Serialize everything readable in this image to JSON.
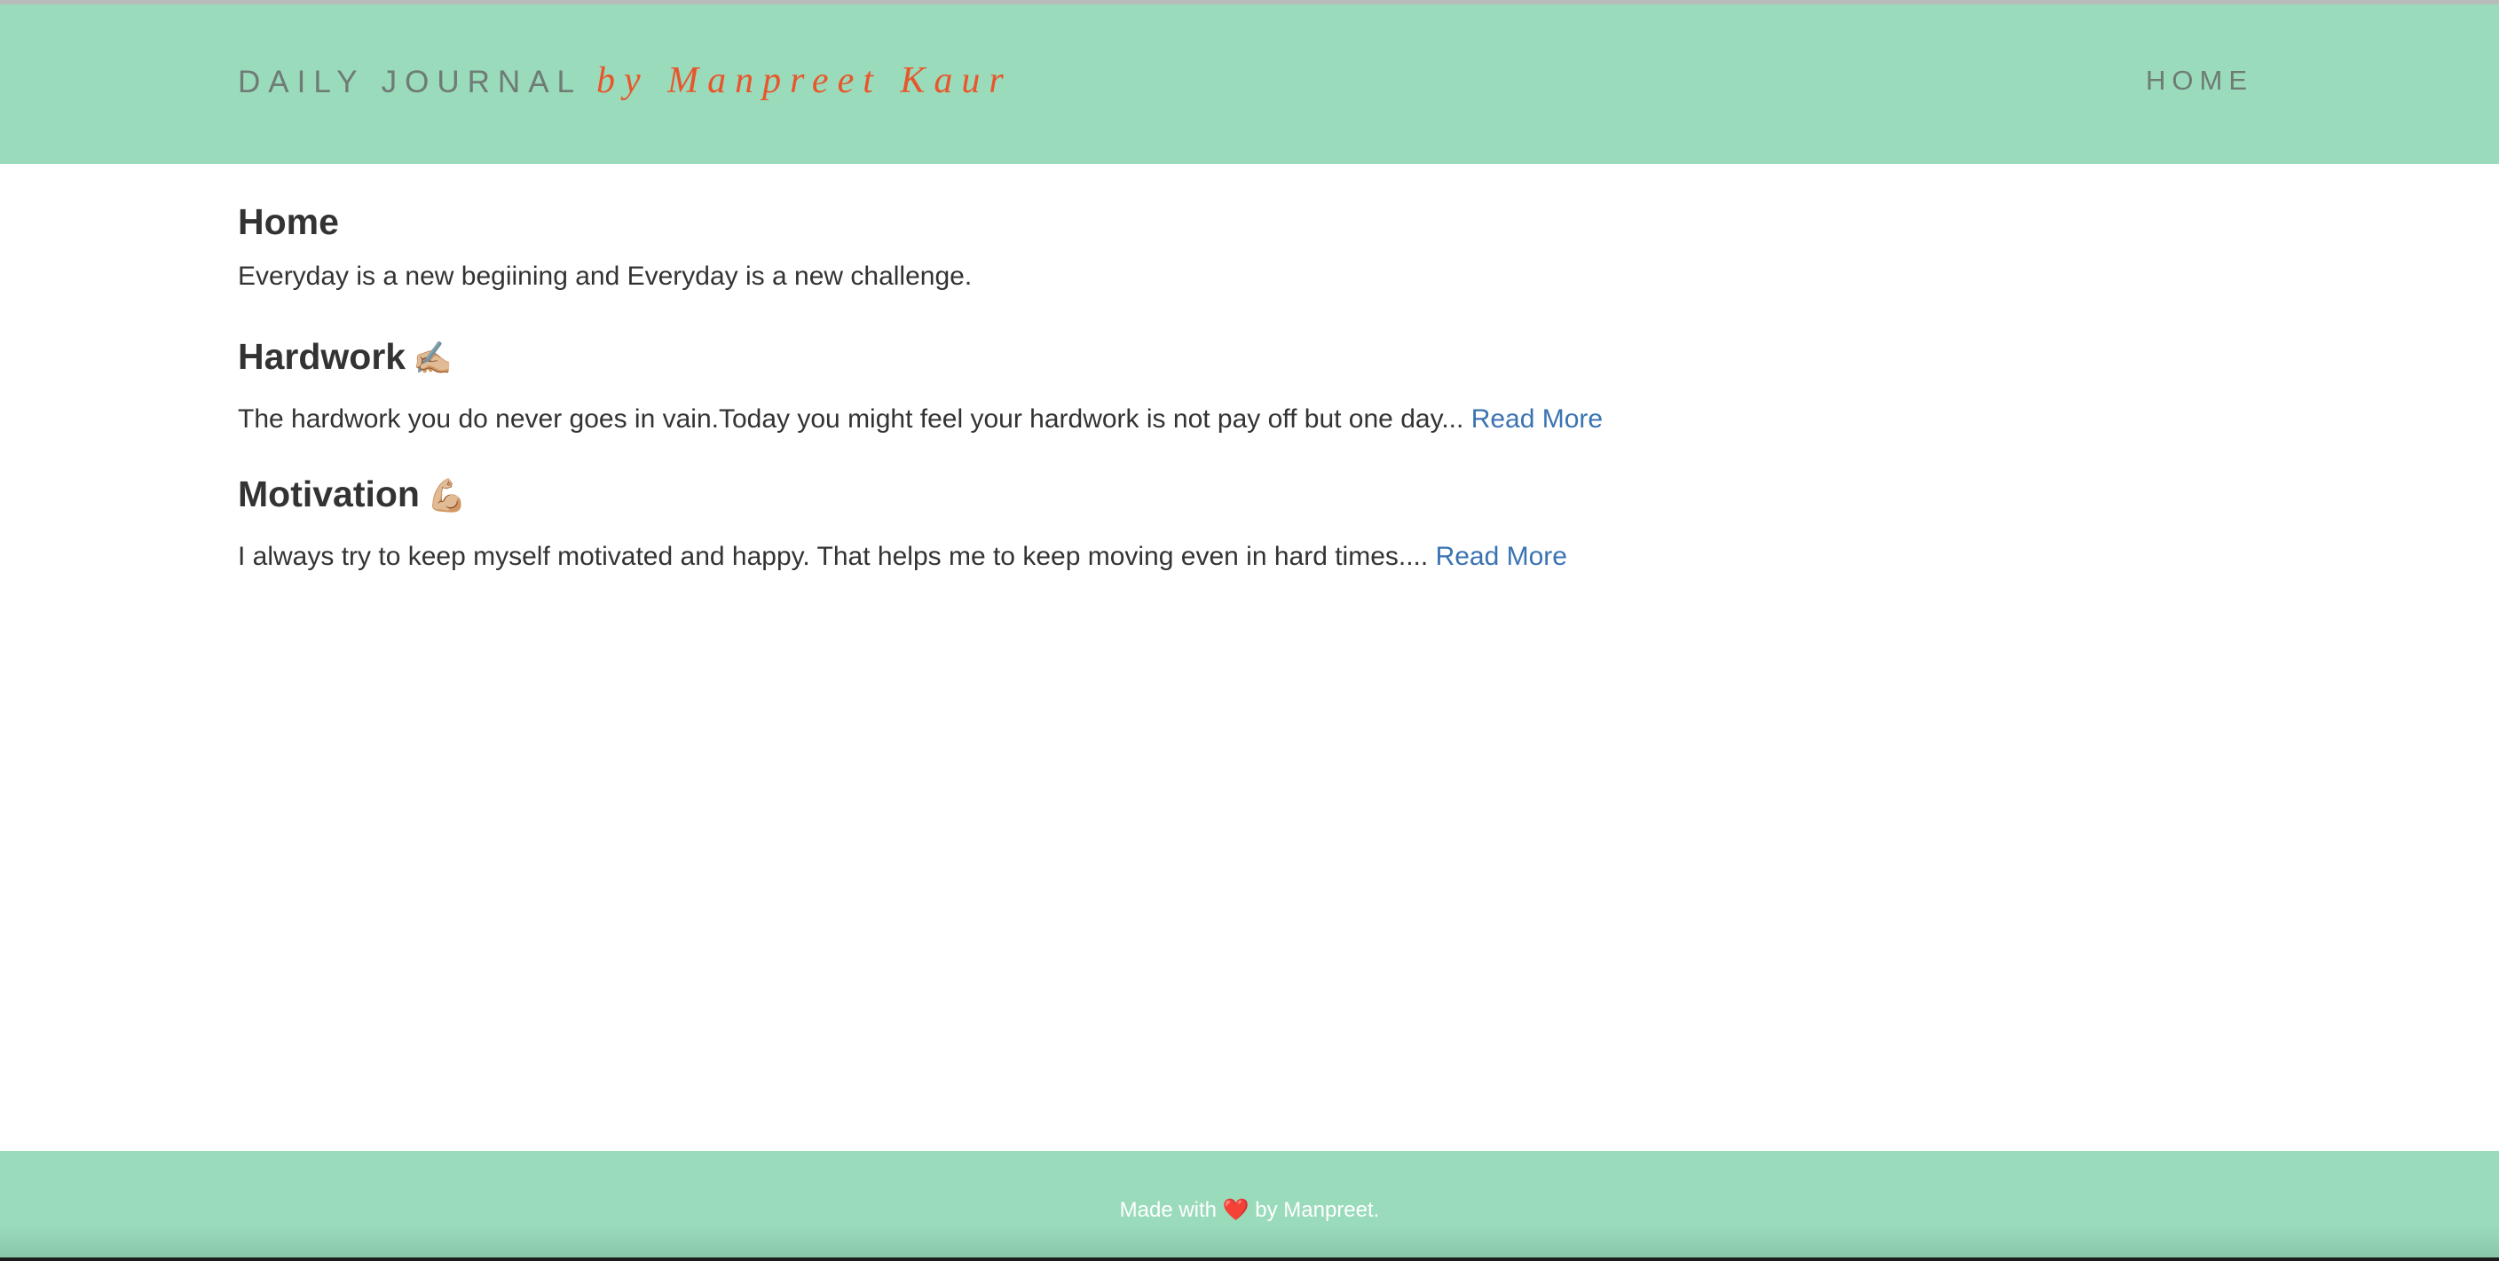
{
  "header": {
    "brand_name": "DAILY JOURNAL",
    "brand_author": "by Manpreet Kaur",
    "nav_home": "HOME"
  },
  "main": {
    "title": "Home",
    "intro": "Everyday is a new begiining and Everyday is a new challenge.",
    "posts": [
      {
        "title": "Hardwork",
        "emoji": "✍🏼",
        "excerpt": "The hardwork you do never goes in vain.Today you might feel your hardwork is not pay off but one day...",
        "read_more": "Read More"
      },
      {
        "title": "Motivation",
        "emoji": "💪🏼",
        "excerpt": "I always try to keep myself motivated and happy. That helps me to keep moving even in hard times....",
        "read_more": "Read More"
      }
    ]
  },
  "footer": {
    "prefix": "Made with",
    "heart": "❤️",
    "suffix": "by Manpreet."
  },
  "colors": {
    "header_bg": "#9adbbb",
    "brand_text": "#6f7b74",
    "author_accent": "#e8562b",
    "link": "#3a73b2",
    "body_text": "#333333"
  }
}
